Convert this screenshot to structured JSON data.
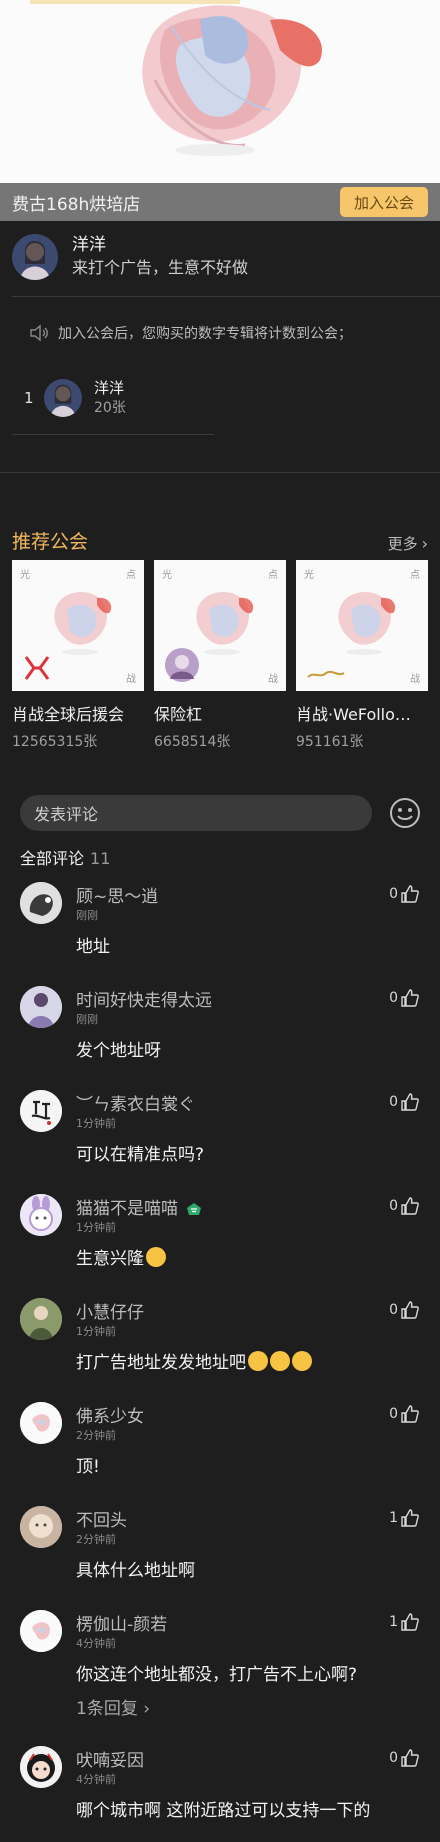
{
  "guild": {
    "name": "费古168h烘培店",
    "join_label": "加入公会"
  },
  "owner": {
    "name": "洋洋",
    "message": "来打个广告，生意不好做"
  },
  "notice": "加入公会后，您购买的数字专辑将计数到公会；",
  "rank": [
    {
      "index": "1",
      "name": "洋洋",
      "count": "20张"
    }
  ],
  "recommend": {
    "title": "推荐公会",
    "more_label": "更多",
    "cards": [
      {
        "name": "肖战全球后援会",
        "count": "12565315张",
        "tl": "光",
        "tr": "点",
        "br": "战"
      },
      {
        "name": "保险杠",
        "count": "6658514张",
        "tl": "光",
        "tr": "点",
        "br": "战"
      },
      {
        "name": "肖战·WeFollo…",
        "count": "951161张",
        "tl": "光",
        "tr": "点",
        "br": "战"
      }
    ]
  },
  "comment_box": {
    "placeholder": "发表评论"
  },
  "all_comments": {
    "label": "全部评论",
    "count": "11"
  },
  "comments": [
    {
      "name": "顾~思～逍",
      "time": "刚刚",
      "likes": "0",
      "body": "地址"
    },
    {
      "name": "时间好快走得太远",
      "time": "刚刚",
      "likes": "0",
      "body": "发个地址呀"
    },
    {
      "name": "︶ㄣ素衣白裳ぐ",
      "time": "1分钟前",
      "likes": "0",
      "body": "可以在精准点吗?"
    },
    {
      "name": "猫猫不是喵喵",
      "time": "1分钟前",
      "likes": "0",
      "body": "生意兴隆"
    },
    {
      "name": "小慧仔仔",
      "time": "1分钟前",
      "likes": "0",
      "body": "打广告地址发发地址吧"
    },
    {
      "name": "佛系少女",
      "time": "2分钟前",
      "likes": "0",
      "body": "顶!"
    },
    {
      "name": "不回头",
      "time": "2分钟前",
      "likes": "1",
      "body": "具体什么地址啊"
    },
    {
      "name": "楞伽山-颜若",
      "time": "4分钟前",
      "likes": "1",
      "body": "你这连个地址都没，打广告不上心啊?",
      "reply": "1条回复"
    },
    {
      "name": "吠喃妥因",
      "time": "4分钟前",
      "likes": "0",
      "body": "哪个城市啊 这附近路过可以支持一下的"
    }
  ],
  "colors": {
    "accent": "#f0b75c",
    "join_bg": "#f7c66b",
    "background": "#1e1e1e"
  }
}
